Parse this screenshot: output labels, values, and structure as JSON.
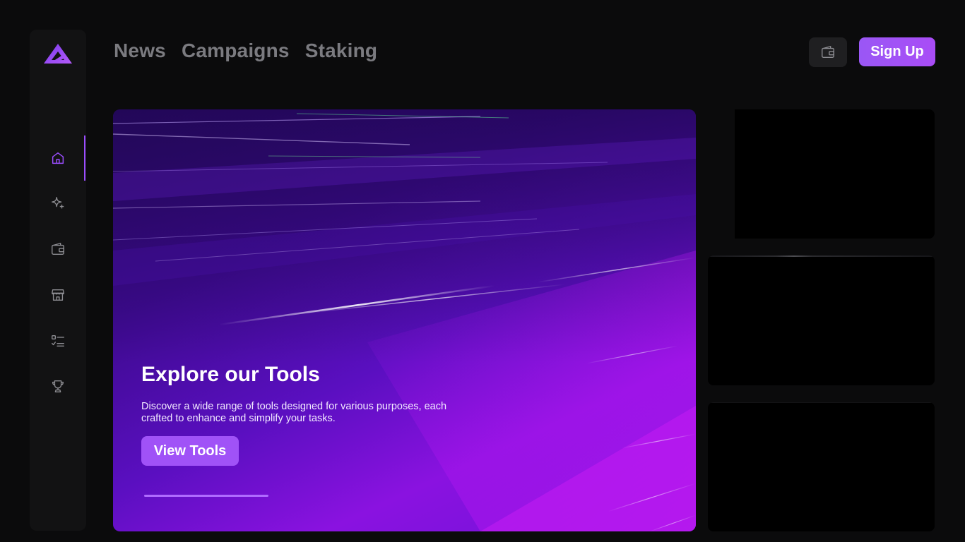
{
  "brand": {
    "logo_icon": "triangle-logo-icon",
    "accent_color": "#9b4dff"
  },
  "sidebar": {
    "items": [
      {
        "icon": "home-icon",
        "active": true
      },
      {
        "icon": "sparkles-icon",
        "active": false
      },
      {
        "icon": "wallet-icon",
        "active": false
      },
      {
        "icon": "store-icon",
        "active": false
      },
      {
        "icon": "checklist-icon",
        "active": false
      },
      {
        "icon": "trophy-icon",
        "active": false
      }
    ]
  },
  "topnav": {
    "links": [
      "News",
      "Campaigns",
      "Staking"
    ]
  },
  "header": {
    "wallet_icon": "wallet-icon",
    "signup_label": "Sign Up"
  },
  "hero": {
    "title": "Explore our Tools",
    "description": "Discover a wide range of tools designed for various purposes, each crafted to enhance and simplify your tasks.",
    "button_label": "View Tools",
    "carousel_progress": 0.42
  }
}
